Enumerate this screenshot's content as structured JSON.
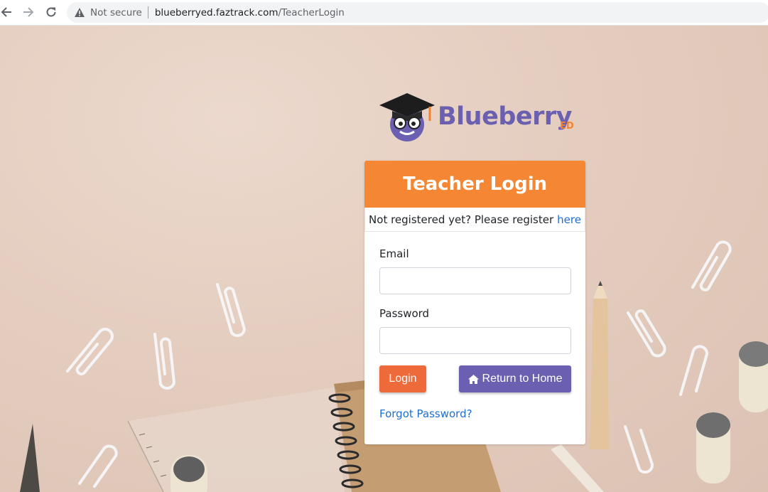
{
  "browser": {
    "security_label": "Not secure",
    "url_host": "blueberryed.faztrack.com",
    "url_path": "/TeacherLogin"
  },
  "logo": {
    "brand": "Blueberry",
    "suffix": "ED"
  },
  "login": {
    "title": "Teacher Login",
    "register_prompt": "Not registered yet? Please register",
    "register_link": "here",
    "email_label": "Email",
    "email_value": "",
    "password_label": "Password",
    "password_value": "",
    "login_button": "Login",
    "home_button": "Return to Home",
    "forgot_link": "Forgot Password?"
  },
  "colors": {
    "header": "#f58634",
    "login_button": "#ef6a3b",
    "home_button": "#6a5fb0",
    "link": "#1f6fd1",
    "brand": "#6b5fb0"
  },
  "icons": {
    "back": "arrow-left-icon",
    "forward": "arrow-right-icon",
    "reload": "reload-icon",
    "security": "warning-triangle-icon",
    "home": "home-icon"
  }
}
